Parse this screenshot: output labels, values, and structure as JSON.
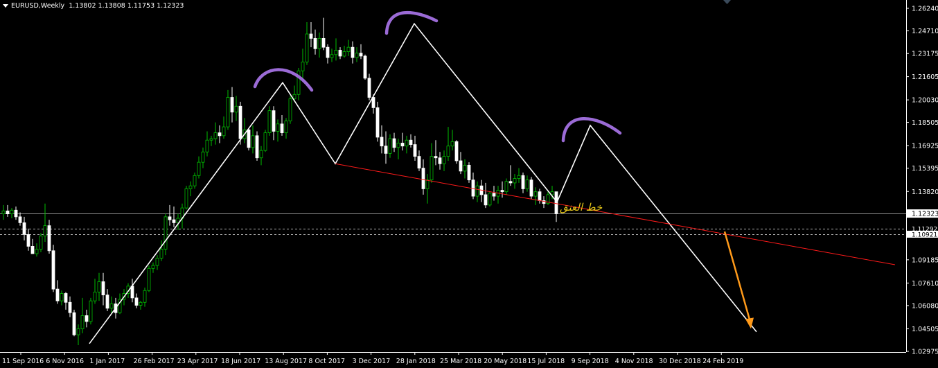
{
  "header": {
    "symbol": "EURUSD,Weekly",
    "ohlc": "1.13802 1.13808 1.11753 1.12323"
  },
  "annotation": {
    "neckline_label": "خط العنق"
  },
  "colors": {
    "background": "#000000",
    "bull": "#00c000",
    "bear": "#ffffff",
    "zigzag": "#ffffff",
    "neckline": "#ff1a1a",
    "arrow": "#ff9a1a",
    "hs_marks": "#9b6bd6",
    "label": "#e6c619",
    "axis": "#ffffff",
    "price_box_bg": "#000000"
  },
  "chart_data": {
    "type": "candlestick",
    "instrument": "EURUSD",
    "timeframe": "Weekly",
    "y_ticks": [
      "1.26240",
      "1.24710",
      "1.23175",
      "1.21605",
      "1.20030",
      "1.18505",
      "1.16925",
      "1.15395",
      "1.13820",
      "1.12323",
      "1.11292",
      "1.10921",
      "1.09185",
      "1.07610",
      "1.06080",
      "1.04505",
      "1.02975"
    ],
    "x_ticks": [
      "11 Sep 2016",
      "6 Nov 2016",
      "1 Jan 2017",
      "26 Feb 2017",
      "23 Apr 2017",
      "18 Jun 2017",
      "13 Aug 2017",
      "8 Oct 2017",
      "3 Dec 2017",
      "28 Jan 2018",
      "25 Mar 2018",
      "20 May 2018",
      "15 Jul 2018",
      "9 Sep 2018",
      "4 Nov 2018",
      "30 Dec 2018",
      "24 Feb 2019"
    ],
    "current_price": 1.12323,
    "dashed_levels": [
      1.11292,
      1.10921
    ],
    "candles": [
      [
        1.123,
        1.129,
        1.119,
        1.125
      ],
      [
        1.125,
        1.129,
        1.121,
        1.123
      ],
      [
        1.123,
        1.127,
        1.12,
        1.1255
      ],
      [
        1.1255,
        1.128,
        1.119,
        1.121
      ],
      [
        1.121,
        1.124,
        1.115,
        1.117
      ],
      [
        1.117,
        1.121,
        1.105,
        1.109
      ],
      [
        1.109,
        1.113,
        1.098,
        1.101
      ],
      [
        1.101,
        1.106,
        1.096,
        1.096
      ],
      [
        1.096,
        1.103,
        1.094,
        1.099
      ],
      [
        1.099,
        1.11,
        1.097,
        1.108
      ],
      [
        1.108,
        1.13,
        1.104,
        1.115
      ],
      [
        1.115,
        1.119,
        1.096,
        1.098
      ],
      [
        1.098,
        1.102,
        1.07,
        1.072
      ],
      [
        1.072,
        1.078,
        1.062,
        1.064
      ],
      [
        1.064,
        1.071,
        1.061,
        1.069
      ],
      [
        1.069,
        1.07,
        1.058,
        1.063
      ],
      [
        1.063,
        1.067,
        1.053,
        1.056
      ],
      [
        1.056,
        1.058,
        1.04,
        1.041
      ],
      [
        1.041,
        1.048,
        1.034,
        1.045
      ],
      [
        1.045,
        1.066,
        1.042,
        1.054
      ],
      [
        1.054,
        1.058,
        1.046,
        1.05
      ],
      [
        1.05,
        1.066,
        1.048,
        1.064
      ],
      [
        1.064,
        1.079,
        1.062,
        1.07
      ],
      [
        1.07,
        1.083,
        1.064,
        1.077
      ],
      [
        1.077,
        1.083,
        1.061,
        1.068
      ],
      [
        1.068,
        1.072,
        1.057,
        1.059
      ],
      [
        1.059,
        1.067,
        1.055,
        1.062
      ],
      [
        1.062,
        1.066,
        1.052,
        1.056
      ],
      [
        1.056,
        1.069,
        1.055,
        1.065
      ],
      [
        1.065,
        1.072,
        1.061,
        1.069
      ],
      [
        1.069,
        1.076,
        1.066,
        1.074
      ],
      [
        1.074,
        1.079,
        1.063,
        1.066
      ],
      [
        1.066,
        1.069,
        1.059,
        1.061
      ],
      [
        1.061,
        1.064,
        1.058,
        1.063
      ],
      [
        1.063,
        1.073,
        1.06,
        1.071
      ],
      [
        1.071,
        1.088,
        1.07,
        1.086
      ],
      [
        1.086,
        1.09,
        1.083,
        1.088
      ],
      [
        1.088,
        1.095,
        1.085,
        1.093
      ],
      [
        1.093,
        1.105,
        1.091,
        1.099
      ],
      [
        1.099,
        1.123,
        1.095,
        1.121
      ],
      [
        1.121,
        1.129,
        1.115,
        1.119
      ],
      [
        1.119,
        1.128,
        1.114,
        1.117
      ],
      [
        1.117,
        1.123,
        1.112,
        1.12
      ],
      [
        1.12,
        1.13,
        1.113,
        1.127
      ],
      [
        1.127,
        1.142,
        1.126,
        1.14
      ],
      [
        1.14,
        1.145,
        1.135,
        1.142
      ],
      [
        1.142,
        1.151,
        1.14,
        1.149
      ],
      [
        1.149,
        1.162,
        1.147,
        1.158
      ],
      [
        1.158,
        1.168,
        1.154,
        1.165
      ],
      [
        1.165,
        1.179,
        1.162,
        1.173
      ],
      [
        1.173,
        1.176,
        1.169,
        1.174
      ],
      [
        1.174,
        1.185,
        1.17,
        1.178
      ],
      [
        1.178,
        1.183,
        1.171,
        1.176
      ],
      [
        1.176,
        1.189,
        1.174,
        1.182
      ],
      [
        1.182,
        1.207,
        1.18,
        1.202
      ],
      [
        1.202,
        1.209,
        1.185,
        1.192
      ],
      [
        1.192,
        1.203,
        1.186,
        1.196
      ],
      [
        1.196,
        1.199,
        1.17,
        1.174
      ],
      [
        1.174,
        1.188,
        1.171,
        1.18
      ],
      [
        1.18,
        1.181,
        1.166,
        1.168
      ],
      [
        1.168,
        1.183,
        1.164,
        1.176
      ],
      [
        1.176,
        1.179,
        1.159,
        1.161
      ],
      [
        1.161,
        1.169,
        1.156,
        1.166
      ],
      [
        1.166,
        1.18,
        1.165,
        1.178
      ],
      [
        1.178,
        1.196,
        1.176,
        1.193
      ],
      [
        1.193,
        1.196,
        1.173,
        1.179
      ],
      [
        1.179,
        1.187,
        1.172,
        1.184
      ],
      [
        1.184,
        1.19,
        1.176,
        1.178
      ],
      [
        1.178,
        1.188,
        1.174,
        1.186
      ],
      [
        1.186,
        1.203,
        1.184,
        1.201
      ],
      [
        1.201,
        1.21,
        1.199,
        1.204
      ],
      [
        1.204,
        1.222,
        1.2,
        1.22
      ],
      [
        1.22,
        1.235,
        1.213,
        1.226
      ],
      [
        1.226,
        1.253,
        1.224,
        1.245
      ],
      [
        1.245,
        1.253,
        1.236,
        1.242
      ],
      [
        1.242,
        1.248,
        1.231,
        1.235
      ],
      [
        1.235,
        1.246,
        1.229,
        1.242
      ],
      [
        1.242,
        1.256,
        1.234,
        1.236
      ],
      [
        1.236,
        1.238,
        1.225,
        1.229
      ],
      [
        1.229,
        1.235,
        1.226,
        1.231
      ],
      [
        1.231,
        1.242,
        1.227,
        1.234
      ],
      [
        1.234,
        1.236,
        1.228,
        1.23
      ],
      [
        1.23,
        1.237,
        1.229,
        1.233
      ],
      [
        1.233,
        1.241,
        1.23,
        1.236
      ],
      [
        1.236,
        1.24,
        1.225,
        1.229
      ],
      [
        1.229,
        1.236,
        1.226,
        1.232
      ],
      [
        1.232,
        1.238,
        1.228,
        1.23
      ],
      [
        1.23,
        1.231,
        1.214,
        1.215
      ],
      [
        1.215,
        1.218,
        1.2,
        1.202
      ],
      [
        1.202,
        1.204,
        1.191,
        1.195
      ],
      [
        1.195,
        1.199,
        1.172,
        1.175
      ],
      [
        1.175,
        1.183,
        1.164,
        1.169
      ],
      [
        1.169,
        1.179,
        1.157,
        1.164
      ],
      [
        1.164,
        1.177,
        1.161,
        1.174
      ],
      [
        1.174,
        1.178,
        1.165,
        1.168
      ],
      [
        1.168,
        1.174,
        1.16,
        1.171
      ],
      [
        1.171,
        1.178,
        1.166,
        1.169
      ],
      [
        1.169,
        1.176,
        1.164,
        1.173
      ],
      [
        1.173,
        1.177,
        1.168,
        1.17
      ],
      [
        1.17,
        1.176,
        1.159,
        1.162
      ],
      [
        1.162,
        1.166,
        1.152,
        1.154
      ],
      [
        1.154,
        1.16,
        1.136,
        1.14
      ],
      [
        1.14,
        1.15,
        1.13,
        1.146
      ],
      [
        1.146,
        1.171,
        1.144,
        1.162
      ],
      [
        1.162,
        1.173,
        1.156,
        1.161
      ],
      [
        1.161,
        1.165,
        1.153,
        1.157
      ],
      [
        1.157,
        1.166,
        1.152,
        1.162
      ],
      [
        1.162,
        1.182,
        1.159,
        1.169
      ],
      [
        1.169,
        1.18,
        1.166,
        1.172
      ],
      [
        1.172,
        1.173,
        1.157,
        1.159
      ],
      [
        1.159,
        1.165,
        1.15,
        1.152
      ],
      [
        1.152,
        1.16,
        1.147,
        1.156
      ],
      [
        1.156,
        1.158,
        1.144,
        1.146
      ],
      [
        1.146,
        1.151,
        1.133,
        1.135
      ],
      [
        1.135,
        1.145,
        1.131,
        1.142
      ],
      [
        1.142,
        1.146,
        1.131,
        1.136
      ],
      [
        1.136,
        1.144,
        1.127,
        1.129
      ],
      [
        1.129,
        1.138,
        1.128,
        1.137
      ],
      [
        1.137,
        1.142,
        1.132,
        1.135
      ],
      [
        1.135,
        1.142,
        1.13,
        1.139
      ],
      [
        1.139,
        1.145,
        1.134,
        1.138
      ],
      [
        1.138,
        1.147,
        1.136,
        1.145
      ],
      [
        1.145,
        1.156,
        1.142,
        1.144
      ],
      [
        1.144,
        1.15,
        1.14,
        1.147
      ],
      [
        1.147,
        1.154,
        1.144,
        1.149
      ],
      [
        1.149,
        1.151,
        1.137,
        1.14
      ],
      [
        1.14,
        1.149,
        1.138,
        1.146
      ],
      [
        1.146,
        1.148,
        1.133,
        1.135
      ],
      [
        1.135,
        1.141,
        1.129,
        1.138
      ],
      [
        1.138,
        1.14,
        1.13,
        1.132
      ],
      [
        1.132,
        1.135,
        1.127,
        1.13
      ],
      [
        1.13,
        1.138,
        1.129,
        1.136
      ],
      [
        1.136,
        1.142,
        1.133,
        1.138
      ],
      [
        1.138,
        1.1381,
        1.1175,
        1.1232
      ]
    ],
    "drawings": {
      "zigzag": [
        [
          0,
          1.035
        ],
        [
          1,
          1.212
        ],
        [
          2,
          1.157
        ],
        [
          3,
          1.252
        ],
        [
          4,
          1.131
        ],
        [
          5,
          1.183
        ],
        [
          6,
          1.043
        ]
      ],
      "neckline": [
        [
          0,
          1.157
        ],
        [
          1,
          1.091
        ]
      ],
      "projection_arrow": [
        [
          0,
          1.111
        ],
        [
          1,
          1.046
        ]
      ]
    }
  }
}
